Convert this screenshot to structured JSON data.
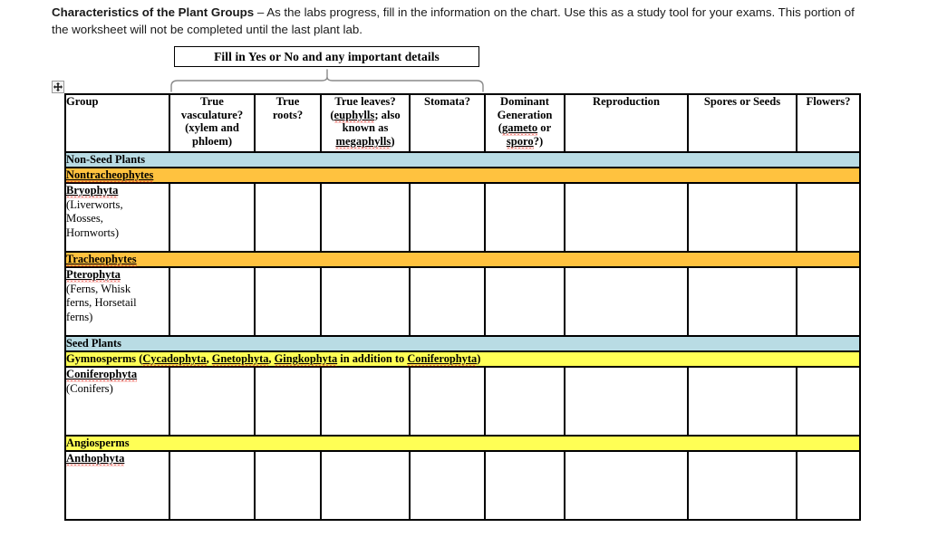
{
  "intro": {
    "lead": "Characteristics of the Plant Groups",
    "body": " – As the labs progress, fill in the information on the chart. Use this as a study tool for your exams. This portion of the worksheet will not be completed until the last plant lab."
  },
  "callout": {
    "text": "Fill in Yes or No and any important details"
  },
  "move_handle": {
    "icon": "move-cross-icon"
  },
  "table": {
    "headers": [
      "Group",
      "True vasculature? (xylem and phloem)",
      "True roots?",
      "True leaves? (euphylls; also known as megaphylls)",
      "Stomata?",
      "Dominant Generation (gameto or sporo?)",
      "Reproduction",
      "Spores or Seeds",
      "Flowers?"
    ],
    "header_parts": {
      "group": "Group",
      "vasculature": [
        "True",
        "vasculature?",
        "(xylem and",
        "phloem)"
      ],
      "roots": [
        "True",
        "roots?"
      ],
      "leaves": {
        "l1": "True leaves?",
        "l2_open": "(",
        "l2_sq": "euphylls",
        "l2_rest": "; also",
        "l3": "known as",
        "l4_sq": "megaphylls",
        "l4_rest": ")"
      },
      "stomata": "Stomata?",
      "dominant": {
        "l1": "Dominant",
        "l2": "Generation",
        "l3_open": "(",
        "l3_sq": "gameto",
        "l3_rest": " or",
        "l4_sq": "sporo",
        "l4_rest": "?)"
      },
      "reproduction": "Reproduction",
      "spores": "Spores or Seeds",
      "flowers": "Flowers?"
    },
    "bands": {
      "non_seed_plants": "Non-Seed Plants",
      "nontracheophytes": "Nontracheophytes",
      "tracheophytes": "Tracheophytes",
      "seed_plants": "Seed Plants",
      "gymnosperms": {
        "prefix": "Gymnosperms (",
        "t1": "Cycadophyta",
        "sep1": ", ",
        "t2": "Gnetophyta",
        "sep2": ", ",
        "t3": "Gingkophyta",
        "mid": " in addition to ",
        "t4": "Coniferophyta",
        "suffix": ")"
      },
      "angiosperms": "Angiosperms"
    },
    "groups": {
      "bryophyta": {
        "name": "Bryophyta",
        "detail_lines": [
          "(Liverworts,",
          "Mosses,",
          "Hornworts)"
        ]
      },
      "pterophyta": {
        "name": "Pterophyta",
        "detail_lines": [
          "(Ferns, Whisk",
          "ferns, Horsetail",
          "ferns)"
        ]
      },
      "coniferophyta": {
        "name": "Coniferophyta",
        "detail_lines": [
          "(Conifers)"
        ]
      },
      "anthophyta": {
        "name": "Anthophyta",
        "detail_lines": []
      }
    }
  },
  "colors": {
    "band_blue": "#b9dce4",
    "band_orange": "#ffc23f",
    "band_yellow": "#ffff55",
    "spellcheck_red": "#e8261a",
    "border": "#000000"
  }
}
